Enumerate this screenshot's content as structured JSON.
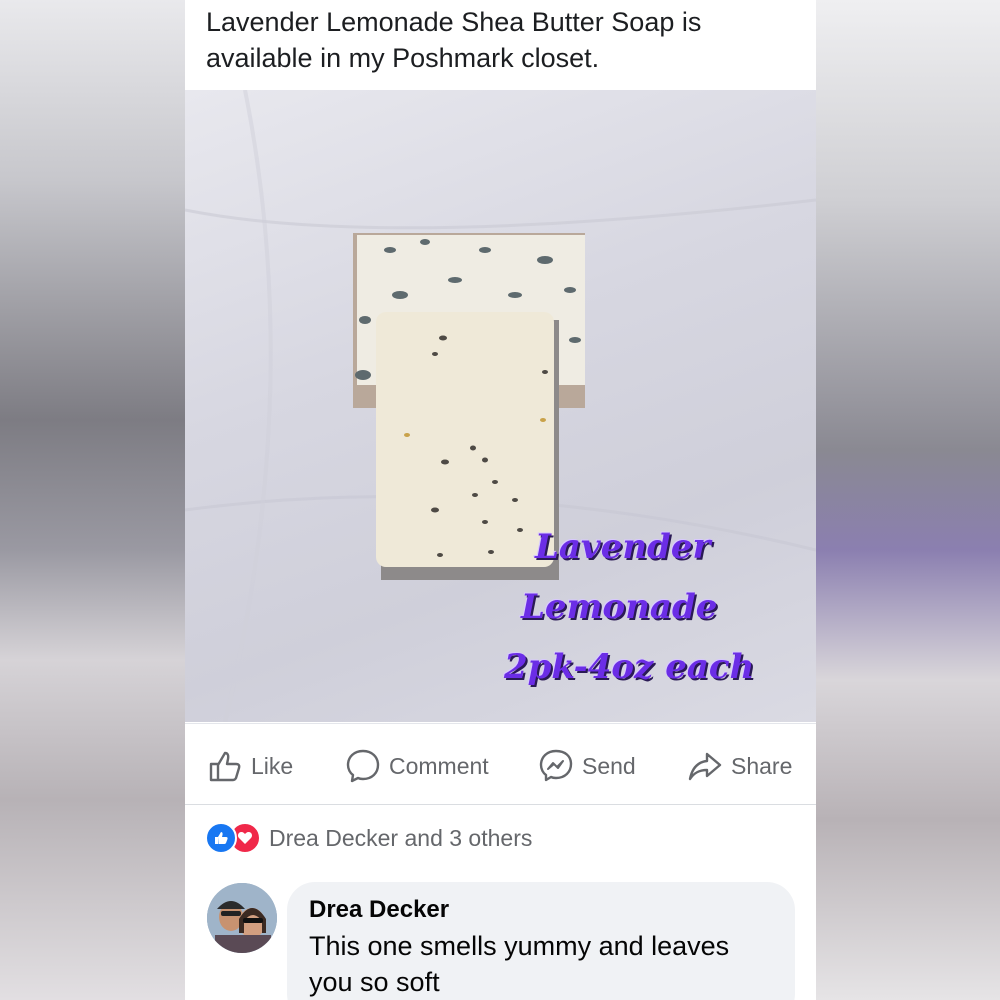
{
  "post": {
    "text": "Lavender Lemonade Shea Butter Soap is available in my Poshmark closet.",
    "photo_overlay": {
      "line1": "Lavender",
      "line2": "Lemonade",
      "line3": "2pk-4oz each",
      "color": "#6b2de6"
    }
  },
  "actions": {
    "like": "Like",
    "comment": "Comment",
    "send": "Send",
    "share": "Share"
  },
  "reactions": {
    "summary": "Drea Decker and 3 others",
    "icons": [
      "like-icon",
      "love-icon"
    ]
  },
  "comment": {
    "author": "Drea Decker",
    "text": "This one smells yummy and leaves you so soft"
  }
}
